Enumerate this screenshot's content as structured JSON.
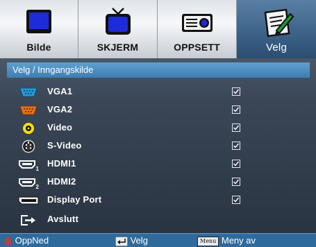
{
  "tabs": [
    {
      "label": "Bilde",
      "icon": "picture-icon"
    },
    {
      "label": "SKJERM",
      "icon": "tv-icon"
    },
    {
      "label": "OPPSETT",
      "icon": "projector-icon"
    },
    {
      "label": "Velg",
      "icon": "notepad-icon",
      "active": true
    }
  ],
  "section": {
    "title": "Velg / Inngangskilde"
  },
  "sources": [
    {
      "label": "VGA1",
      "icon": "vga-connector-icon",
      "icon_color": "#2a9bd6",
      "checked": true
    },
    {
      "label": "VGA2",
      "icon": "vga-connector-icon",
      "icon_color": "#e8731a",
      "checked": true
    },
    {
      "label": "Video",
      "icon": "rca-jack-icon",
      "icon_color": "#f5e100",
      "checked": true
    },
    {
      "label": "S-Video",
      "icon": "svideo-port-icon",
      "checked": true
    },
    {
      "label": "HDMI1",
      "icon": "hdmi-port-icon",
      "subscript": "1",
      "checked": true
    },
    {
      "label": "HDMI2",
      "icon": "hdmi-port-icon",
      "subscript": "2",
      "checked": true
    },
    {
      "label": "Display Port",
      "icon": "displayport-icon",
      "checked": true
    }
  ],
  "exit": {
    "label": "Avslutt",
    "icon": "exit-icon"
  },
  "bottom": {
    "updown_label": "OppNed",
    "enter_label": "Velg",
    "menu_key": "Menu",
    "menu_label": "Meny av"
  },
  "colors": {
    "accent": "#3d7eb4",
    "active_tab": "#3b6187",
    "bottom_bar": "#2f6a9c"
  }
}
